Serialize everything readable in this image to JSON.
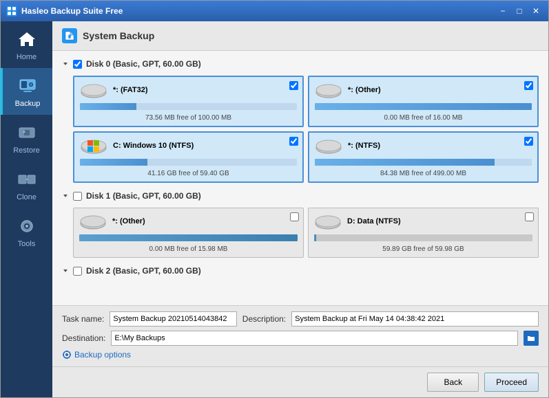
{
  "window": {
    "title": "Hasleo Backup Suite Free",
    "minimize_label": "−",
    "maximize_label": "□",
    "close_label": "✕"
  },
  "sidebar": {
    "items": [
      {
        "id": "home",
        "label": "Home",
        "active": false
      },
      {
        "id": "backup",
        "label": "Backup",
        "active": true
      },
      {
        "id": "restore",
        "label": "Restore",
        "active": false
      },
      {
        "id": "clone",
        "label": "Clone",
        "active": false
      },
      {
        "id": "tools",
        "label": "Tools",
        "active": false
      }
    ]
  },
  "header": {
    "title": "System Backup"
  },
  "disks": [
    {
      "id": "disk0",
      "label": "Disk 0 (Basic, GPT, 60.00 GB)",
      "checked": true,
      "partitions": [
        {
          "label": "*: (FAT32)",
          "checked": true,
          "free": "73.56 MB free of 100.00 MB",
          "bar_pct": 26,
          "has_windows": false,
          "selected": true
        },
        {
          "label": "*: (Other)",
          "checked": true,
          "free": "0.00 MB free of 16.00 MB",
          "bar_pct": 100,
          "has_windows": false,
          "selected": true
        },
        {
          "label": "C: Windows 10 (NTFS)",
          "checked": true,
          "free": "41.16 GB free of 59.40 GB",
          "bar_pct": 31,
          "has_windows": true,
          "selected": true
        },
        {
          "label": "*: (NTFS)",
          "checked": true,
          "free": "84.38 MB free of 499.00 MB",
          "bar_pct": 83,
          "has_windows": false,
          "selected": true
        }
      ]
    },
    {
      "id": "disk1",
      "label": "Disk 1 (Basic, GPT, 60.00 GB)",
      "checked": false,
      "partitions": [
        {
          "label": "*: (Other)",
          "checked": false,
          "free": "0.00 MB free of 15.98 MB",
          "bar_pct": 100,
          "has_windows": false,
          "selected": false
        },
        {
          "label": "D: Data (NTFS)",
          "checked": false,
          "free": "59.89 GB free of 59.98 GB",
          "bar_pct": 1,
          "has_windows": false,
          "selected": false
        }
      ]
    },
    {
      "id": "disk2",
      "label": "Disk 2 (Basic, GPT, 60.00 GB)",
      "checked": false,
      "partitions": []
    }
  ],
  "form": {
    "task_name_label": "Task name:",
    "task_name_value": "System Backup 20210514043842",
    "description_label": "Description:",
    "description_value": "System Backup at Fri May 14 04:38:42 2021",
    "destination_label": "Destination:",
    "destination_value": "E:\\My Backups",
    "backup_options_label": "Backup options",
    "gear_icon": "⚙"
  },
  "actions": {
    "back_label": "Back",
    "proceed_label": "Proceed"
  }
}
